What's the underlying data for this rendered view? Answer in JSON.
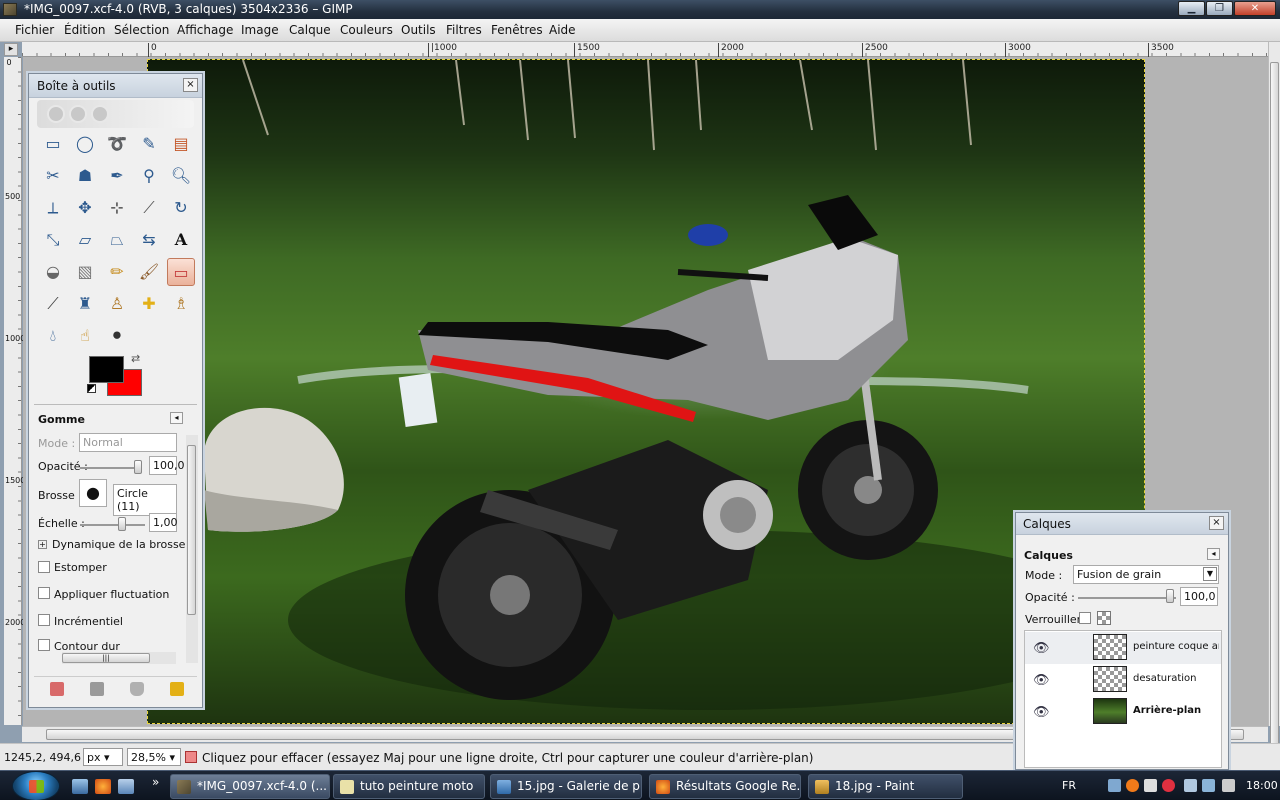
{
  "window": {
    "title": "*IMG_0097.xcf-4.0 (RVB, 3 calques) 3504x2336 – GIMP",
    "minimize": "▁",
    "maximize": "❐",
    "close": "✕"
  },
  "menu": [
    "Fichier",
    "Édition",
    "Sélection",
    "Affichage",
    "Image",
    "Calque",
    "Couleurs",
    "Outils",
    "Filtres",
    "Fenêtres",
    "Aide"
  ],
  "ruler": {
    "h_ticks": [
      "0",
      "|1000",
      "1500",
      "2000",
      "2500",
      "3000",
      "3500"
    ],
    "v_ticks": [
      "0",
      "500",
      "1000",
      "1500",
      "2000"
    ]
  },
  "toolbox": {
    "title": "Boîte à outils",
    "close": "×",
    "foreground_color": "#000000",
    "background_color": "#ff0000",
    "tool_options": {
      "heading": "Gomme",
      "mode_label": "Mode :",
      "mode_value": "Normal",
      "opacity_label": "Opacité :",
      "opacity_value": "100,0",
      "opacity_level": 1.0,
      "brush_label": "Brosse :",
      "brush_value": "Circle (11)",
      "scale_label": "Échelle :",
      "scale_value": "1,00",
      "dynamics_label": "Dynamique de la brosse",
      "checkboxes": [
        "Estomper",
        "Appliquer fluctuation",
        "Incrémentiel",
        "Contour dur"
      ]
    },
    "bottom_icons": [
      "save-options-icon",
      "restore-options-icon",
      "delete-options-icon",
      "reset-options-icon"
    ]
  },
  "tools": [
    "rect-select-icon",
    "ellipse-select-icon",
    "lasso-icon",
    "fuzzy-select-icon",
    "color-select-icon",
    "scissors-icon",
    "foreground-select-icon",
    "paths-icon",
    "color-picker-icon",
    "zoom-icon",
    "measure-icon",
    "move-icon",
    "align-icon",
    "crop-icon",
    "rotate-icon",
    "scale-icon",
    "shear-icon",
    "perspective-icon",
    "flip-icon",
    "text-icon",
    "bucket-fill-icon",
    "blend-icon",
    "pencil-icon",
    "paintbrush-icon",
    "eraser-icon",
    "airbrush-icon",
    "ink-icon",
    "clone-icon",
    "heal-icon",
    "perspective-clone-icon",
    "blur-icon",
    "smudge-icon",
    "dodge-burn-icon"
  ],
  "layers_dock": {
    "title": "Calques",
    "close": "×",
    "header": "Calques",
    "mode_label": "Mode :",
    "mode_value": "Fusion de grain",
    "opacity_label": "Opacité :",
    "opacity_value": "100,0",
    "lock_label": "Verrouiller :",
    "layers": [
      {
        "name": "peinture coque arrière",
        "bold": false
      },
      {
        "name": "desaturation",
        "bold": false
      },
      {
        "name": "Arrière-plan",
        "bold": true
      }
    ]
  },
  "status": {
    "coords": "1245,2, 494,6",
    "unit": "px",
    "zoom": "28,5%",
    "message": "Cliquez pour effacer (essayez Maj pour une ligne droite, Ctrl pour capturer une couleur d'arrière-plan)"
  },
  "taskbar": {
    "tasks": [
      {
        "label": "*IMG_0097.xcf-4.0 (...",
        "active": true
      },
      {
        "label": "tuto peinture moto",
        "active": false
      },
      {
        "label": "15.jpg - Galerie de p...",
        "active": false
      },
      {
        "label": "Résultats Google Re...",
        "active": false
      },
      {
        "label": "18.jpg - Paint",
        "active": false
      }
    ],
    "overflow": "»",
    "language": "FR",
    "clock": "18:00"
  },
  "colors": {
    "accent_titlebar": "#24303f",
    "selection_border": "#e8d23a",
    "active_tool": "#eab19a"
  }
}
